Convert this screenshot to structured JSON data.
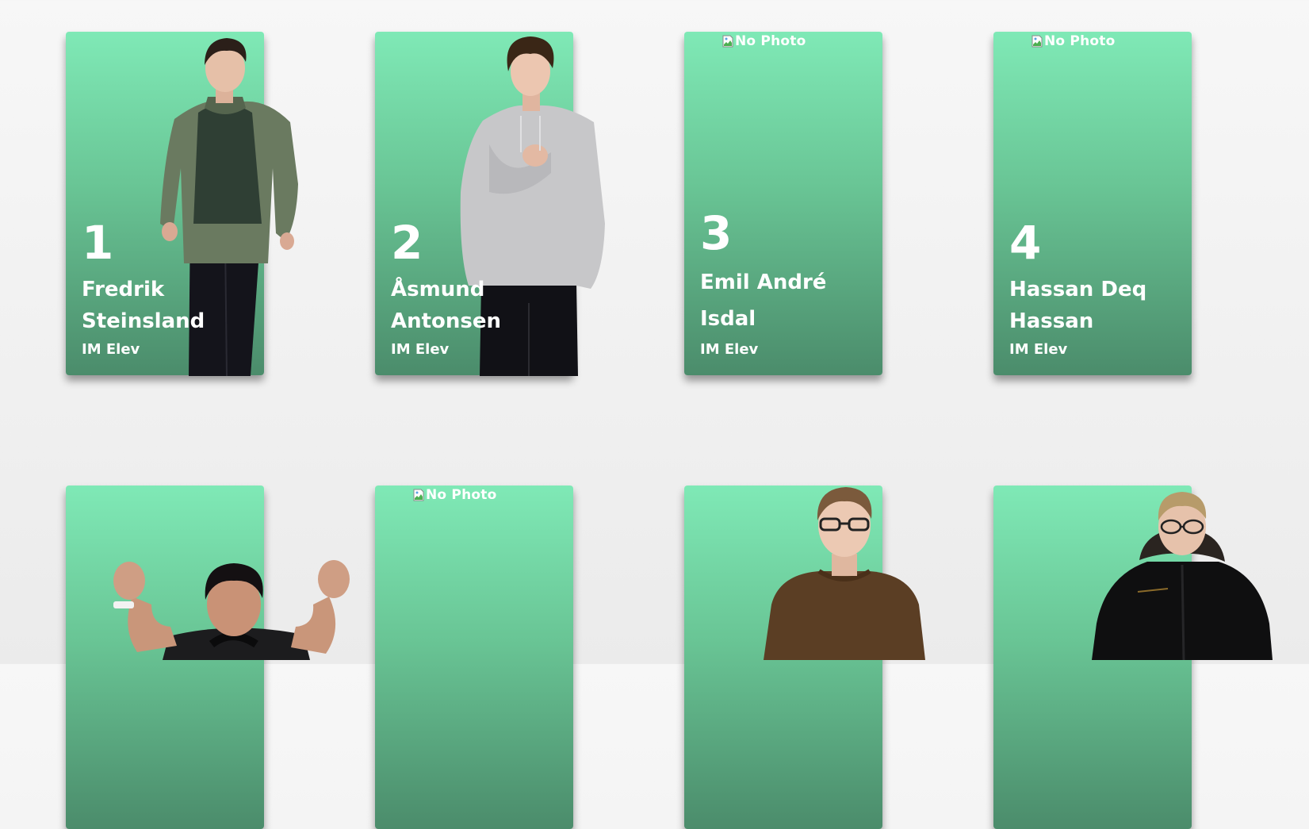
{
  "broken_image_alt": "No Photo",
  "colors": {
    "card_top": "#7fe9b6",
    "card_bottom": "#4b8c6b",
    "text": "#ffffff"
  },
  "students": [
    {
      "number": "1",
      "name": "Fredrik Steinsland",
      "role": "IM Elev",
      "photo": "standing-jacket"
    },
    {
      "number": "2",
      "name": "Åsmund Antonsen",
      "role": "IM Elev",
      "photo": "standing-hoodie"
    },
    {
      "number": "3",
      "name": "Emil André Isdal",
      "role": "IM Elev",
      "photo": "none"
    },
    {
      "number": "4",
      "name": "Hassan Deq Hassan",
      "role": "IM Elev",
      "photo": "none"
    },
    {
      "photo": "thumbs-pointing"
    },
    {
      "photo": "none"
    },
    {
      "photo": "sweater-glasses"
    },
    {
      "photo": "black-jacket-glasses"
    }
  ]
}
